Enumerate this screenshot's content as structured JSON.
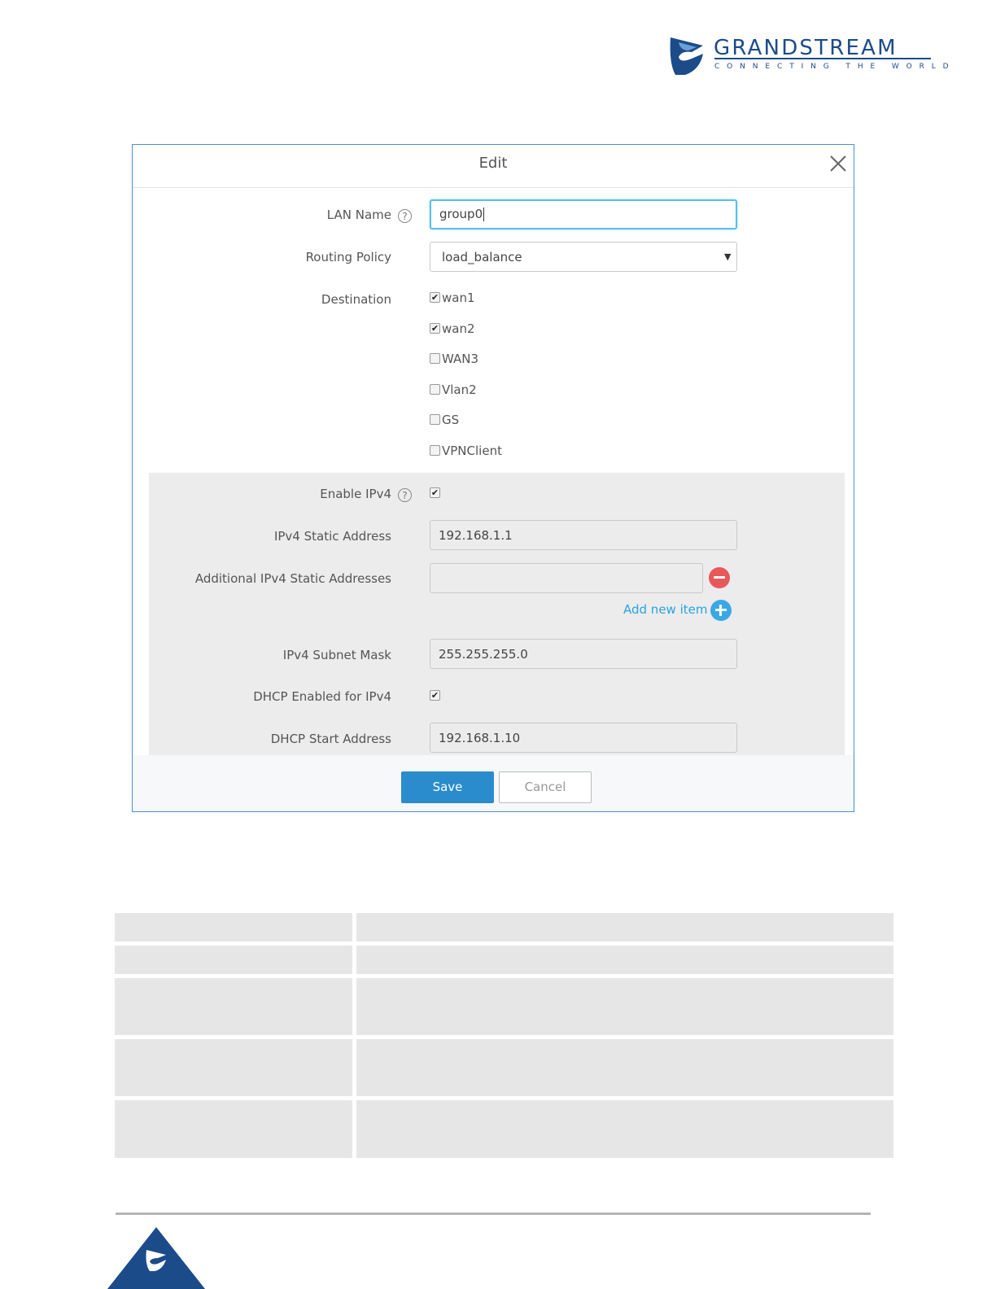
{
  "brand": {
    "name": "GRANDSTREAM",
    "tagline": "CONNECTING THE WORLD",
    "primary_color": "#1c4b8a",
    "logo_icon": "grandstream-logo-icon"
  },
  "dialog": {
    "title": "Edit",
    "close_icon": "close-icon",
    "fields": {
      "lan_name_label": "LAN Name",
      "lan_name_value": "group0",
      "routing_policy_label": "Routing Policy",
      "routing_policy_value": "load_balance",
      "destination_label": "Destination",
      "destinations": [
        {
          "label": "wan1",
          "checked": true
        },
        {
          "label": "wan2",
          "checked": true
        },
        {
          "label": "WAN3",
          "checked": false
        },
        {
          "label": "Vlan2",
          "checked": false
        },
        {
          "label": "GS",
          "checked": false
        },
        {
          "label": "VPNClient",
          "checked": false
        }
      ],
      "enable_ipv4_label": "Enable IPv4",
      "enable_ipv4_checked": true,
      "ipv4_static_label": "IPv4 Static Address",
      "ipv4_static_value": "192.168.1.1",
      "additional_ipv4_label": "Additional IPv4 Static Addresses",
      "additional_ipv4_value": "",
      "add_new_item": "Add new item",
      "subnet_mask_label": "IPv4 Subnet Mask",
      "subnet_mask_value": "255.255.255.0",
      "dhcp_enabled_label": "DHCP Enabled for IPv4",
      "dhcp_enabled_checked": true,
      "dhcp_start_label": "DHCP Start Address",
      "dhcp_start_value": "192.168.1.10"
    },
    "buttons": {
      "save": "Save",
      "cancel": "Cancel"
    },
    "help_glyph": "?",
    "check_glyph": "✔",
    "caret_glyph": "▼",
    "accent_color": "#2a8ccc",
    "remove_color": "#e8575a",
    "add_color": "#3aa8e6"
  }
}
